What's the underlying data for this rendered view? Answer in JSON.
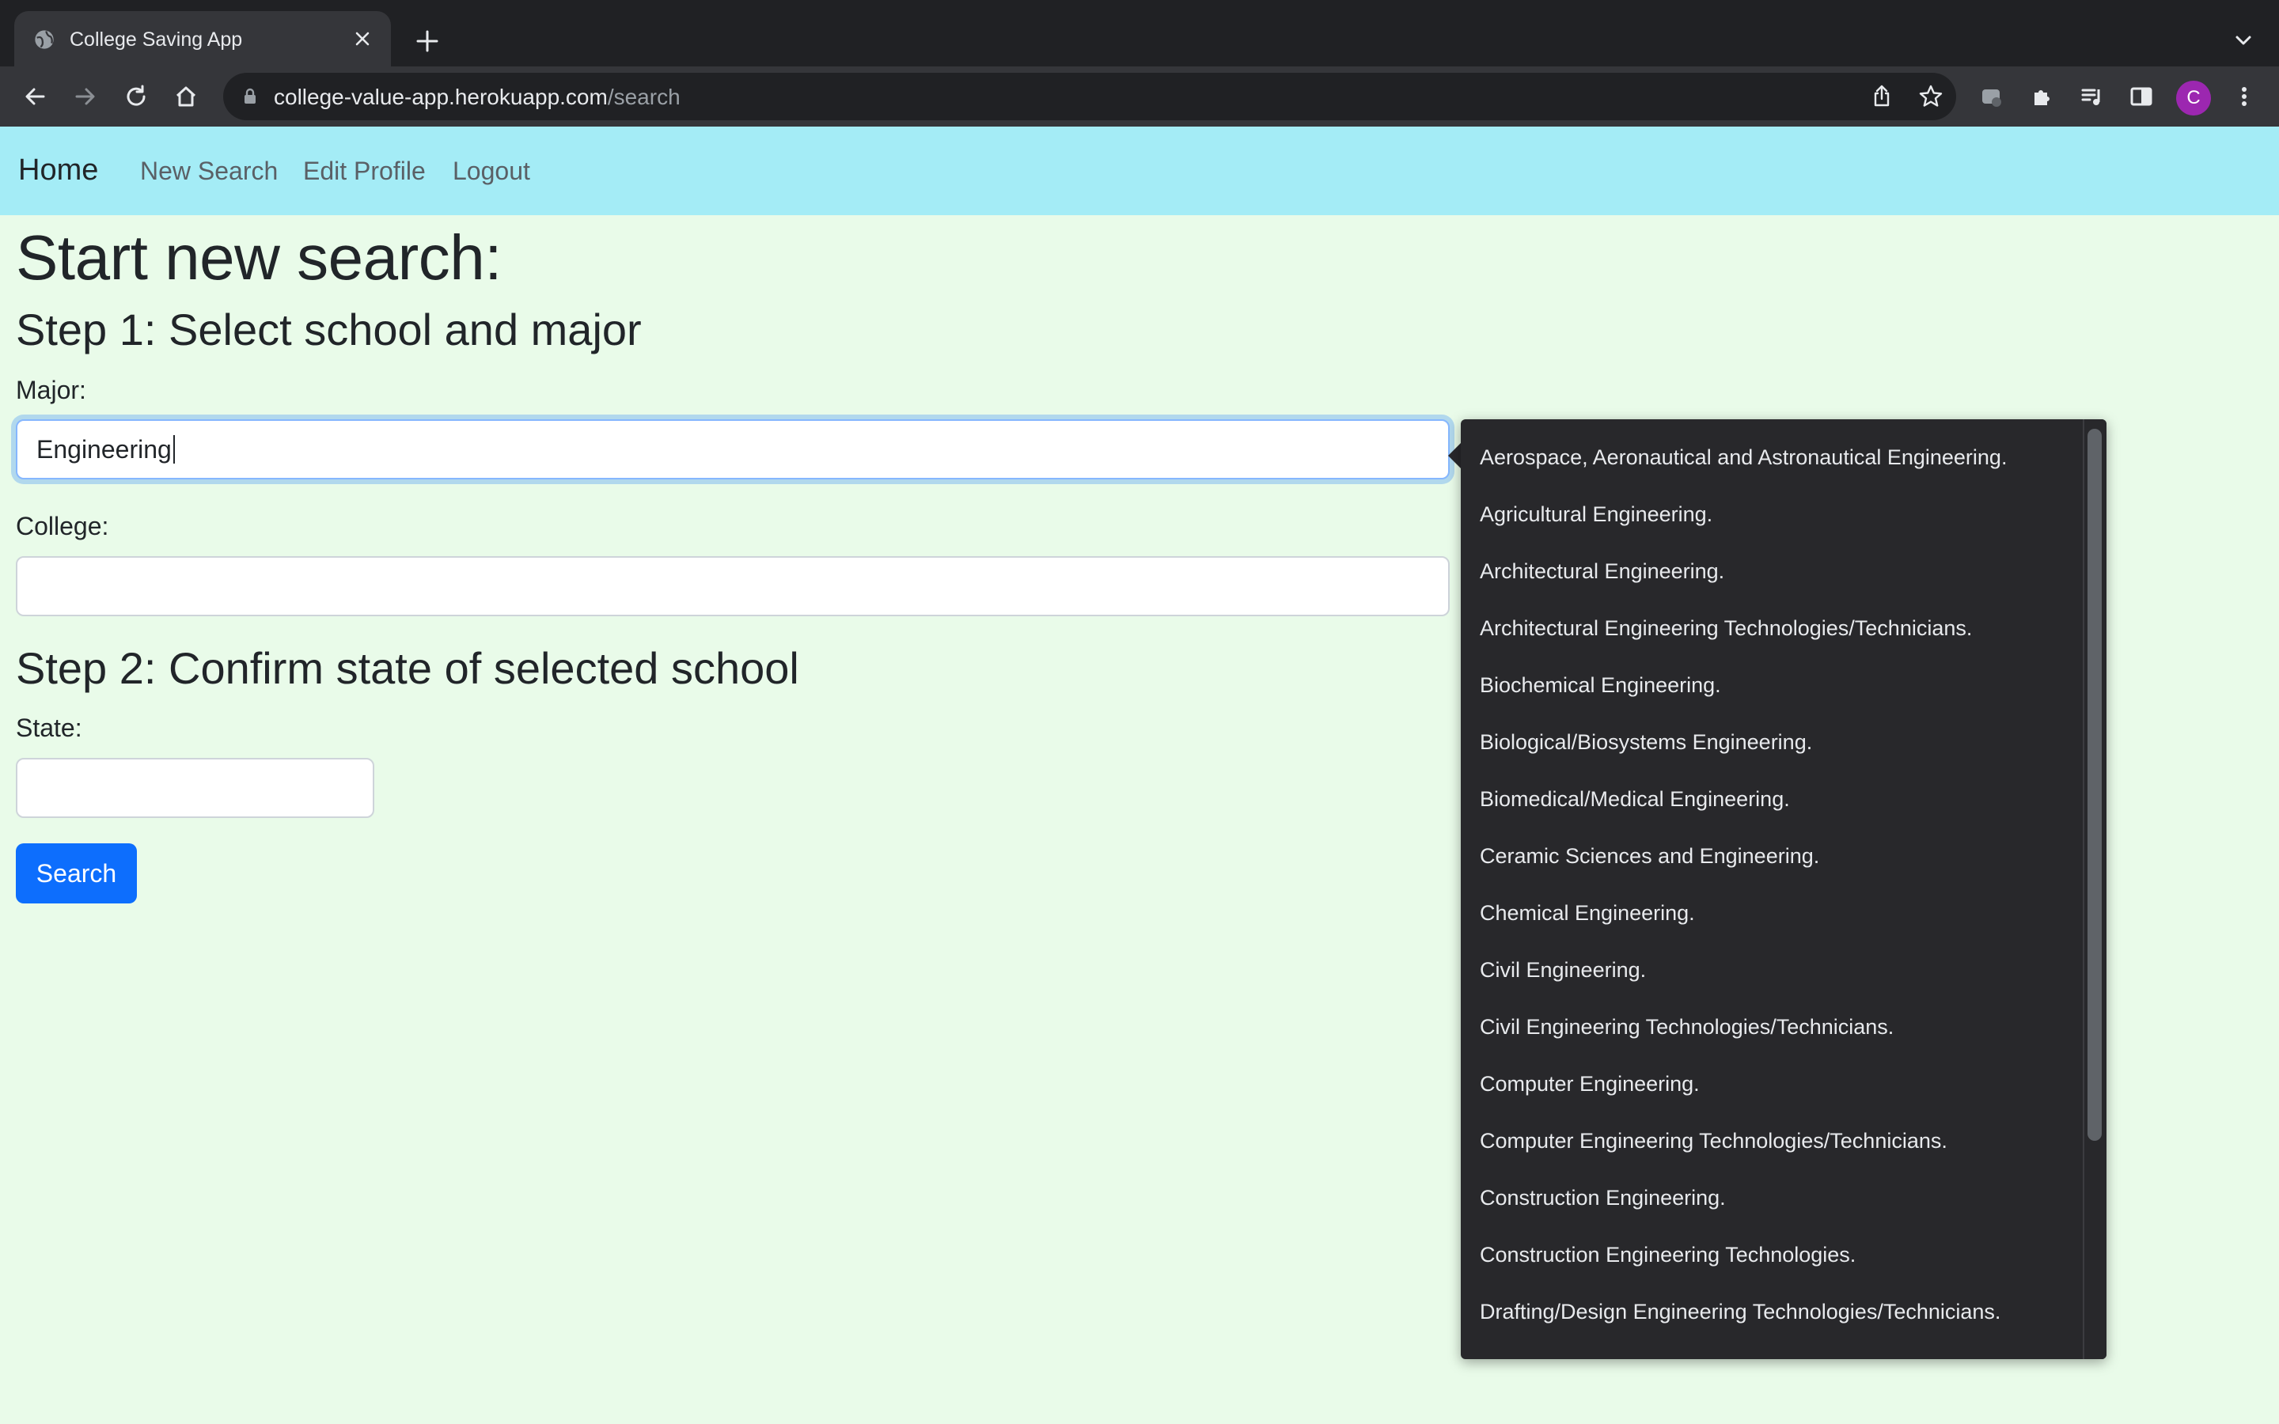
{
  "browser": {
    "tab_title": "College Saving App",
    "url_host": "college-value-app.herokuapp.com",
    "url_path": "/search",
    "profile_initial": "C"
  },
  "nav": {
    "brand": "Home",
    "links": [
      "New Search",
      "Edit Profile",
      "Logout"
    ]
  },
  "page": {
    "title": "Start new search:",
    "step1_heading": "Step 1: Select school and major",
    "major_label": "Major:",
    "major_value": "Engineering",
    "college_label": "College:",
    "college_value": "",
    "step2_heading": "Step 2: Confirm state of selected school",
    "state_label": "State:",
    "state_value": "",
    "search_button": "Search"
  },
  "suggestions": [
    "Aerospace, Aeronautical and Astronautical Engineering.",
    "Agricultural Engineering.",
    "Architectural Engineering.",
    "Architectural Engineering Technologies/Technicians.",
    "Biochemical Engineering.",
    "Biological/Biosystems Engineering.",
    "Biomedical/Medical Engineering.",
    "Ceramic Sciences and Engineering.",
    "Chemical Engineering.",
    "Civil Engineering.",
    "Civil Engineering Technologies/Technicians.",
    "Computer Engineering.",
    "Computer Engineering Technologies/Technicians.",
    "Construction Engineering.",
    "Construction Engineering Technologies.",
    "Drafting/Design Engineering Technologies/Technicians."
  ],
  "colors": {
    "page_bg": "#e9fbe9",
    "navbar_bg": "#a4ecf6",
    "primary": "#0d6efd",
    "popup_bg": "#28282b"
  }
}
